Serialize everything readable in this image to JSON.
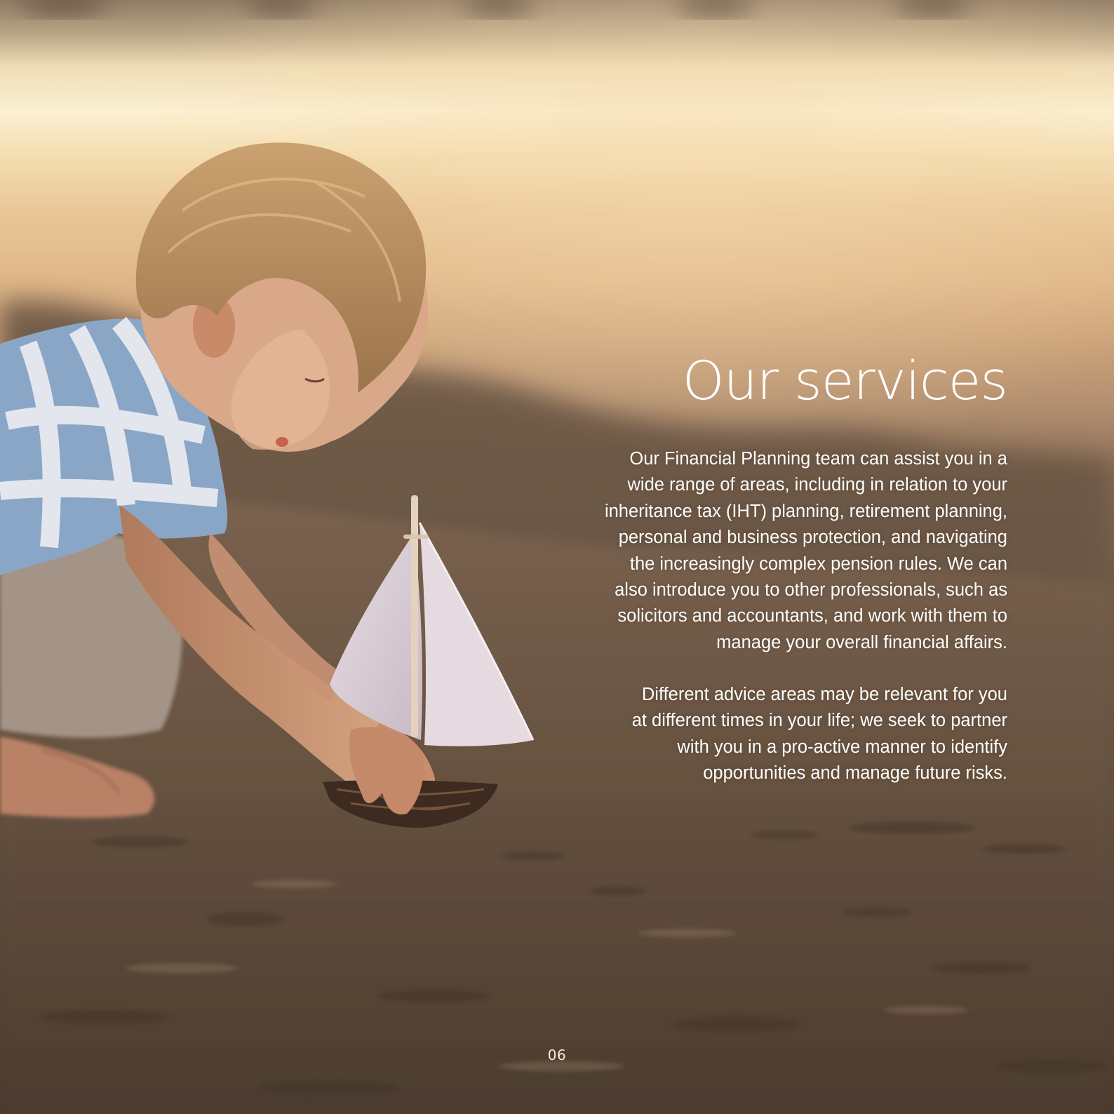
{
  "page": {
    "title": "Our services",
    "paragraph_1_lines": [
      "Our Financial Planning team can assist you in a",
      "wide range of areas, including in relation to your",
      "inheritance tax (IHT) planning, retirement planning,",
      "personal and business protection, and navigating",
      "the increasingly complex pension rules. We can",
      "also introduce you to other professionals, such as",
      "solicitors and accountants, and work with them to",
      "manage your overall financial affairs."
    ],
    "paragraph_2_lines": [
      "Different advice areas may be relevant for you",
      "at different times in your life; we seek to partner",
      "with you in a pro-active manner to identify",
      "opportunities and manage future risks."
    ],
    "page_number": "06"
  },
  "colors": {
    "text": "#ffffff",
    "sky_light": "#f8e8c4",
    "sand_dark": "#4f3f31"
  }
}
